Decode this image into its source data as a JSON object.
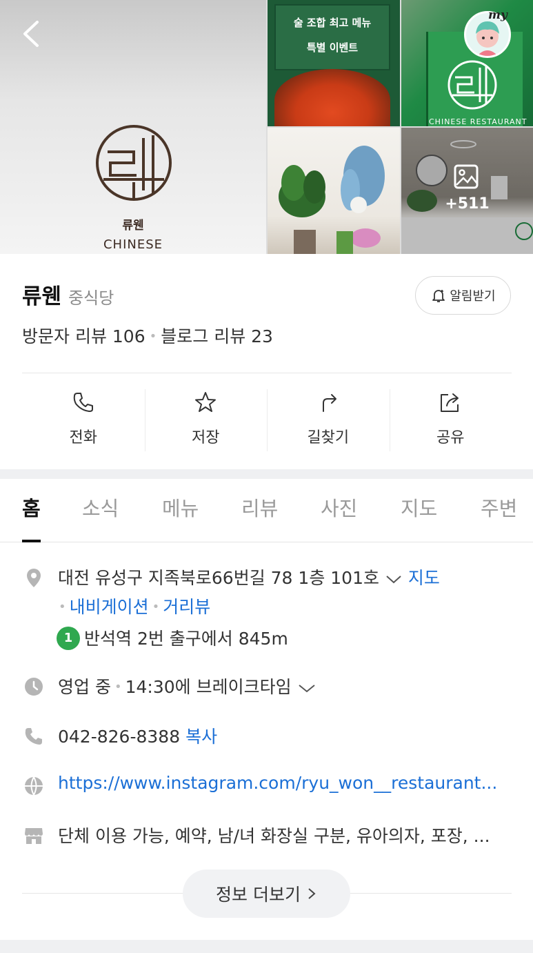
{
  "hero": {
    "logo_name": "류웬",
    "logo_sub": "CHINESE",
    "banner_line1": "술 조합 최고 메뉴",
    "banner_line2": "특별 이벤트",
    "store_text": "CHINESE RESTAURANT",
    "photo_count": "+511",
    "my_badge": "my"
  },
  "place": {
    "name": "류웬",
    "category": "중식당",
    "alarm_label": "알림받기",
    "visitor_review": "방문자 리뷰 106",
    "blog_review": "블로그 리뷰 23"
  },
  "actions": [
    {
      "label": "전화",
      "icon": "phone-icon"
    },
    {
      "label": "저장",
      "icon": "star-icon"
    },
    {
      "label": "길찾기",
      "icon": "directions-icon"
    },
    {
      "label": "공유",
      "icon": "share-icon"
    }
  ],
  "tabs": [
    {
      "label": "홈",
      "active": true
    },
    {
      "label": "소식"
    },
    {
      "label": "메뉴"
    },
    {
      "label": "리뷰"
    },
    {
      "label": "사진"
    },
    {
      "label": "지도"
    },
    {
      "label": "주변"
    }
  ],
  "info": {
    "address": "대전 유성구 지족북로66번길 78 1층 101호",
    "map_link": "지도",
    "navigation_link": "내비게이션",
    "street_view_link": "거리뷰",
    "subway_line": "1",
    "subway_text": "반석역 2번 출구에서 845m",
    "hours_status": "영업 중",
    "hours_detail": "14:30에 브레이크타임",
    "phone": "042-826-8388",
    "copy_label": "복사",
    "website": "https://www.instagram.com/ryu_won__restaurant...",
    "amenities": "단체 이용 가능, 예약, 남/녀 화장실 구분, 유아의자, 포장, ...",
    "more_label": "정보 더보기"
  },
  "colors": {
    "accent_link": "#1b6fd6",
    "subway_green": "#2fa84f",
    "brand_green": "#1f8a45"
  }
}
